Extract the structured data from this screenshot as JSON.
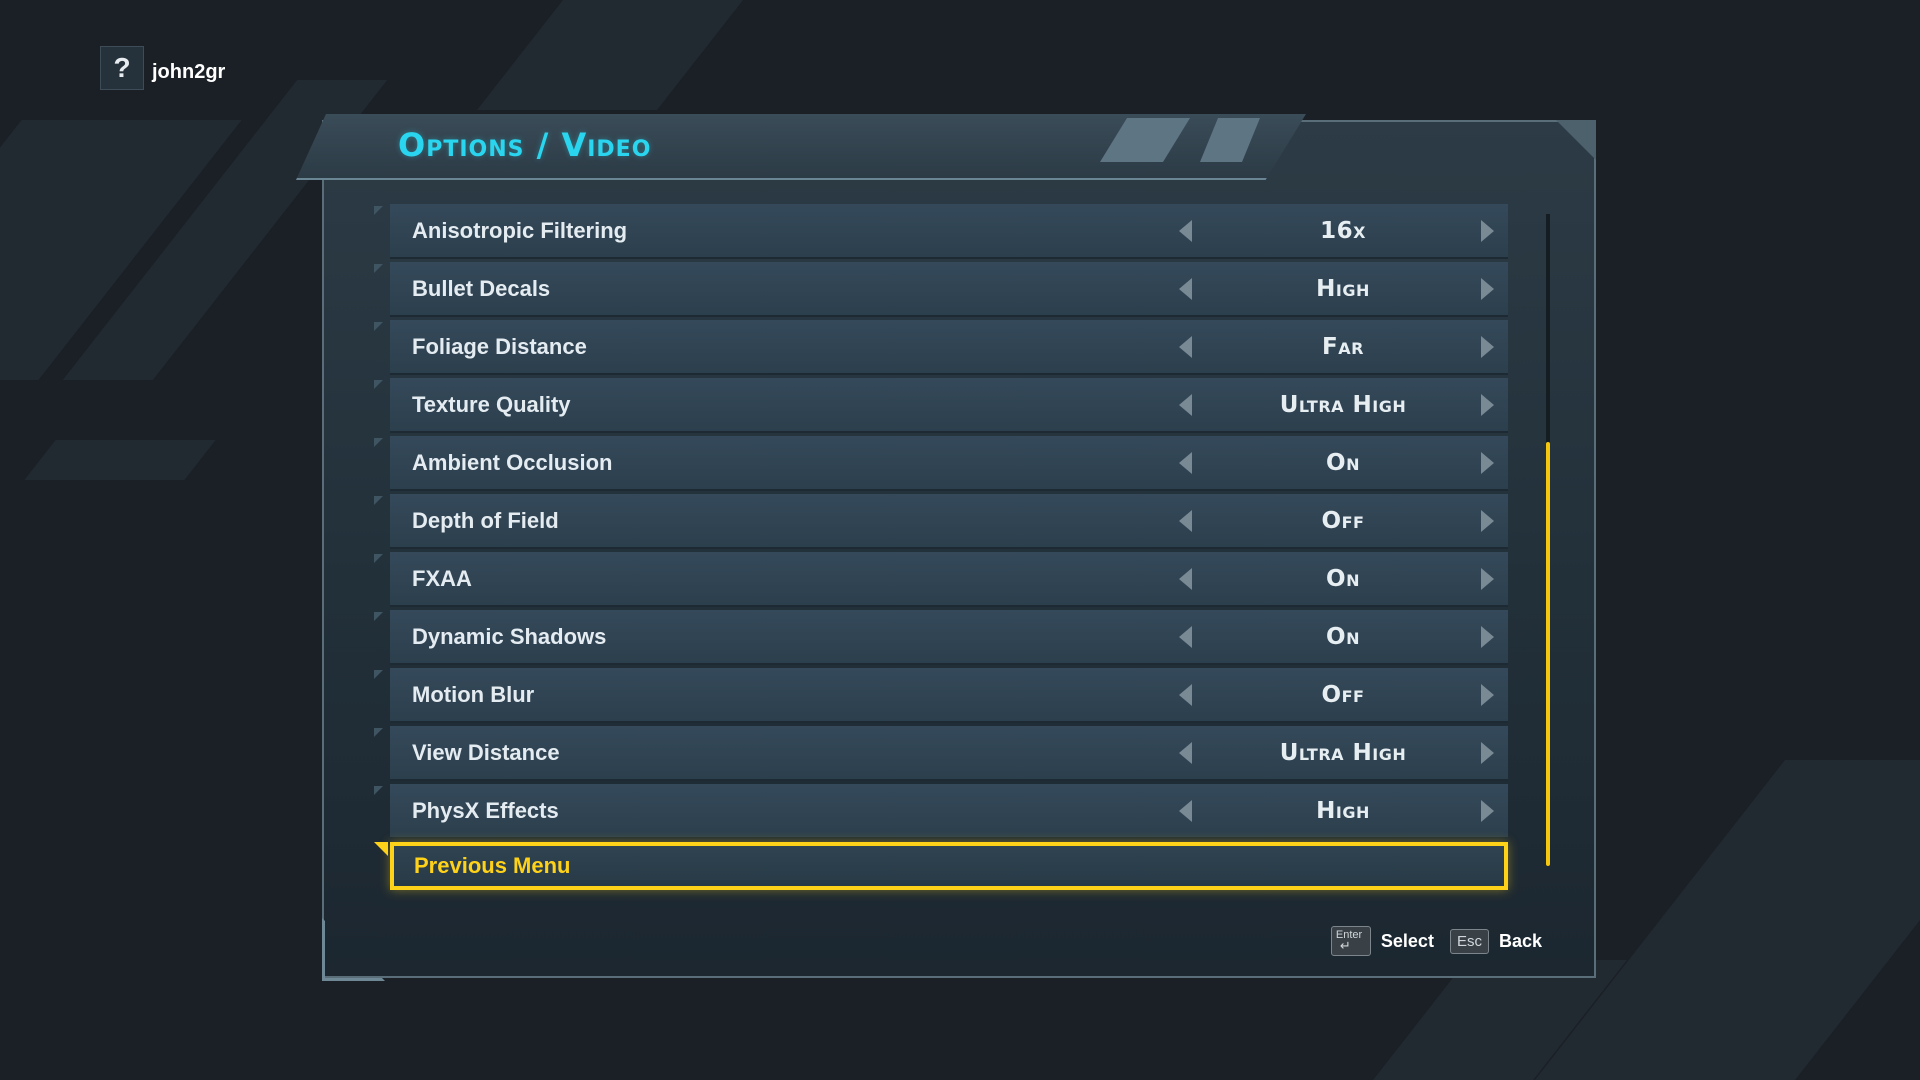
{
  "profile": {
    "avatar_glyph": "?",
    "username": "john2gr"
  },
  "title": "Options / Video",
  "options": [
    {
      "label": "Anisotropic Filtering",
      "value": "16x"
    },
    {
      "label": "Bullet Decals",
      "value": "High"
    },
    {
      "label": "Foliage Distance",
      "value": "Far"
    },
    {
      "label": "Texture Quality",
      "value": "Ultra High"
    },
    {
      "label": "Ambient Occlusion",
      "value": "On"
    },
    {
      "label": "Depth of Field",
      "value": "Off"
    },
    {
      "label": "FXAA",
      "value": "On"
    },
    {
      "label": "Dynamic Shadows",
      "value": "On"
    },
    {
      "label": "Motion Blur",
      "value": "Off"
    },
    {
      "label": "View Distance",
      "value": "Ultra High"
    },
    {
      "label": "PhysX Effects",
      "value": "High"
    }
  ],
  "previous_menu": "Previous Menu",
  "scrollbar": {
    "thumb_start": 0.35,
    "thumb_end": 1.0
  },
  "hints": {
    "enter_key": "Enter",
    "select_label": "Select",
    "esc_key": "Esc",
    "back_label": "Back"
  },
  "colors": {
    "accent": "#ffd21a",
    "title": "#2ad6ef",
    "text": "#e4ecf1"
  }
}
